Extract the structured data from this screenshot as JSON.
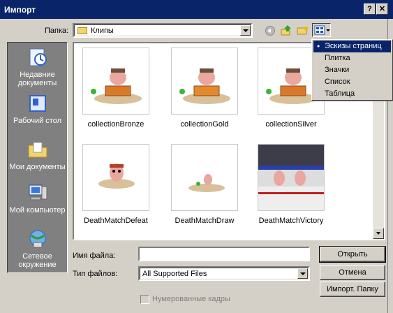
{
  "window": {
    "title": "Импорт",
    "help_glyph": "?",
    "close_glyph": "✕"
  },
  "folder": {
    "label": "Папка:",
    "value": "Клипы"
  },
  "places": [
    {
      "name": "recent",
      "label": "Недавние документы"
    },
    {
      "name": "desktop",
      "label": "Рабочий стол"
    },
    {
      "name": "documents",
      "label": "Мои документы"
    },
    {
      "name": "computer",
      "label": "Мой компьютер"
    },
    {
      "name": "network",
      "label": "Сетевое окружение"
    }
  ],
  "thumbnails": [
    {
      "name": "collectionBronze"
    },
    {
      "name": "collectionGold"
    },
    {
      "name": "collectionSilver"
    },
    {
      "name": "DeathMatchDefeat"
    },
    {
      "name": "DeathMatchDraw"
    },
    {
      "name": "DeathMatchVictory"
    }
  ],
  "view_menu": {
    "items": [
      {
        "label": "Эскизы страниц",
        "selected": true
      },
      {
        "label": "Плитка",
        "selected": false
      },
      {
        "label": "Значки",
        "selected": false
      },
      {
        "label": "Список",
        "selected": false
      },
      {
        "label": "Таблица",
        "selected": false
      }
    ]
  },
  "file_name": {
    "label": "Имя файла:",
    "value": ""
  },
  "file_type": {
    "label": "Тип файлов:",
    "value": "All Supported Files"
  },
  "buttons": {
    "open": "Открыть",
    "cancel": "Отмена",
    "import_folder": "Импорт. Папку"
  },
  "numbered_frames": {
    "label": "Нумерованные кадры",
    "checked": false,
    "enabled": false
  },
  "colors": {
    "titlebar": "#0a246a",
    "face": "#d4d0c8",
    "places_bg": "#808080"
  }
}
